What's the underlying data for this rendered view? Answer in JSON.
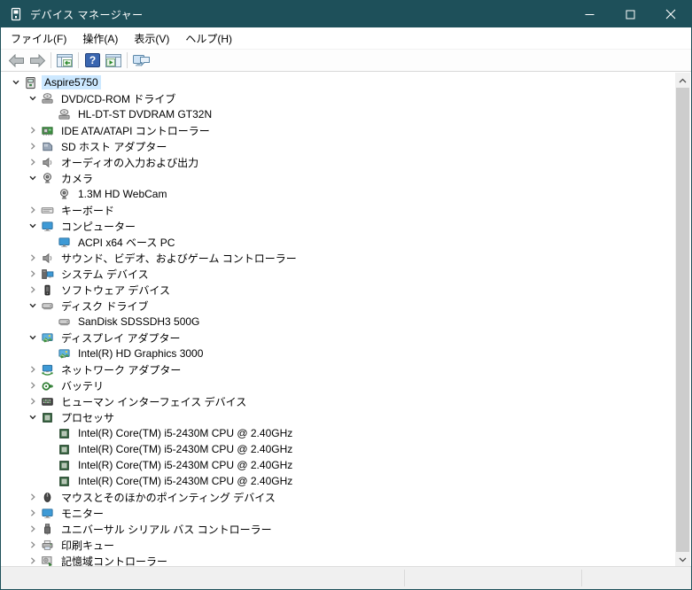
{
  "window": {
    "title": "デバイス マネージャー",
    "controls": [
      {
        "name": "minimize-button"
      },
      {
        "name": "maximize-button"
      },
      {
        "name": "close-button"
      }
    ]
  },
  "colors": {
    "titlebar": "#1e505a",
    "selection": "#cce8ff",
    "toolbar_border": "#d7d7d7",
    "statusbar": "#f0f0f0",
    "help_icon_blue": "#3a66b0",
    "accent_green": "#2e8b2e"
  },
  "menu": {
    "items": [
      {
        "label": "ファイル(F)"
      },
      {
        "label": "操作(A)"
      },
      {
        "label": "表示(V)"
      },
      {
        "label": "ヘルプ(H)"
      }
    ]
  },
  "toolbar": {
    "buttons": [
      {
        "name": "back-icon"
      },
      {
        "name": "forward-icon"
      },
      {
        "name": "show-hide-console-tree-icon"
      },
      {
        "name": "help-icon"
      },
      {
        "name": "action-pane-icon"
      },
      {
        "name": "scan-hardware-changes-icon"
      }
    ]
  },
  "tree": {
    "rows": [
      {
        "label": "Aspire5750",
        "level": 0,
        "state": "expanded",
        "icon": "computer-device-icon",
        "selected": true
      },
      {
        "label": "DVD/CD-ROM ドライブ",
        "level": 1,
        "state": "expanded",
        "icon": "dvd-drive-icon"
      },
      {
        "label": "HL-DT-ST DVDRAM GT32N",
        "level": 2,
        "state": "leaf",
        "icon": "dvd-drive-icon"
      },
      {
        "label": "IDE ATA/ATAPI コントローラー",
        "level": 1,
        "state": "collapsed",
        "icon": "ide-controller-icon"
      },
      {
        "label": "SD ホスト アダプター",
        "level": 1,
        "state": "collapsed",
        "icon": "sd-host-adapter-icon"
      },
      {
        "label": "オーディオの入力および出力",
        "level": 1,
        "state": "collapsed",
        "icon": "audio-icon"
      },
      {
        "label": "カメラ",
        "level": 1,
        "state": "expanded",
        "icon": "camera-icon"
      },
      {
        "label": "1.3M HD WebCam",
        "level": 2,
        "state": "leaf",
        "icon": "camera-icon"
      },
      {
        "label": "キーボード",
        "level": 1,
        "state": "collapsed",
        "icon": "keyboard-icon"
      },
      {
        "label": "コンピューター",
        "level": 1,
        "state": "expanded",
        "icon": "monitor-icon"
      },
      {
        "label": "ACPI x64 ベース PC",
        "level": 2,
        "state": "leaf",
        "icon": "monitor-icon"
      },
      {
        "label": "サウンド、ビデオ、およびゲーム コントローラー",
        "level": 1,
        "state": "collapsed",
        "icon": "audio-icon"
      },
      {
        "label": "システム デバイス",
        "level": 1,
        "state": "collapsed",
        "icon": "system-devices-icon"
      },
      {
        "label": "ソフトウェア デバイス",
        "level": 1,
        "state": "collapsed",
        "icon": "software-device-icon"
      },
      {
        "label": "ディスク ドライブ",
        "level": 1,
        "state": "expanded",
        "icon": "disk-drive-icon"
      },
      {
        "label": "SanDisk SDSSDH3 500G",
        "level": 2,
        "state": "leaf",
        "icon": "disk-drive-icon"
      },
      {
        "label": "ディスプレイ アダプター",
        "level": 1,
        "state": "expanded",
        "icon": "display-adapter-icon"
      },
      {
        "label": "Intel(R) HD Graphics 3000",
        "level": 2,
        "state": "leaf",
        "icon": "display-adapter-icon"
      },
      {
        "label": "ネットワーク アダプター",
        "level": 1,
        "state": "collapsed",
        "icon": "network-adapter-icon"
      },
      {
        "label": "バッテリ",
        "level": 1,
        "state": "collapsed",
        "icon": "battery-icon"
      },
      {
        "label": "ヒューマン インターフェイス デバイス",
        "level": 1,
        "state": "collapsed",
        "icon": "hid-icon"
      },
      {
        "label": "プロセッサ",
        "level": 1,
        "state": "expanded",
        "icon": "processor-icon"
      },
      {
        "label": "Intel(R) Core(TM) i5-2430M CPU @ 2.40GHz",
        "level": 2,
        "state": "leaf",
        "icon": "processor-icon"
      },
      {
        "label": "Intel(R) Core(TM) i5-2430M CPU @ 2.40GHz",
        "level": 2,
        "state": "leaf",
        "icon": "processor-icon"
      },
      {
        "label": "Intel(R) Core(TM) i5-2430M CPU @ 2.40GHz",
        "level": 2,
        "state": "leaf",
        "icon": "processor-icon"
      },
      {
        "label": "Intel(R) Core(TM) i5-2430M CPU @ 2.40GHz",
        "level": 2,
        "state": "leaf",
        "icon": "processor-icon"
      },
      {
        "label": "マウスとそのほかのポインティング デバイス",
        "level": 1,
        "state": "collapsed",
        "icon": "mouse-icon"
      },
      {
        "label": "モニター",
        "level": 1,
        "state": "collapsed",
        "icon": "monitor-icon"
      },
      {
        "label": "ユニバーサル シリアル バス コントローラー",
        "level": 1,
        "state": "collapsed",
        "icon": "usb-icon"
      },
      {
        "label": "印刷キュー",
        "level": 1,
        "state": "collapsed",
        "icon": "printer-icon"
      },
      {
        "label": "記憶域コントローラー",
        "level": 1,
        "state": "collapsed",
        "icon": "storage-controller-icon"
      }
    ]
  }
}
